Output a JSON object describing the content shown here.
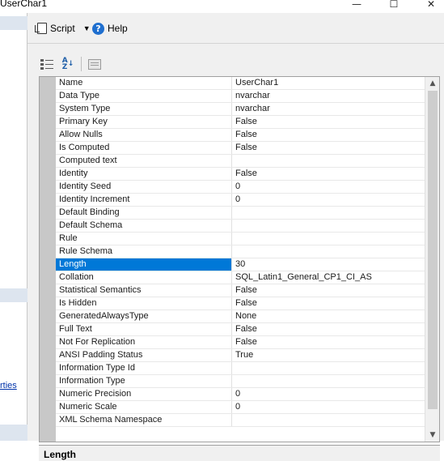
{
  "window": {
    "title": "UserChar1",
    "controls": {
      "minimize": "—",
      "maximize": "☐",
      "close": "✕"
    }
  },
  "left_pane": {
    "link_text": "rties"
  },
  "toolbar": {
    "script_label": "Script",
    "help_label": "Help"
  },
  "property_toolbar": {
    "categorized_icon": "categorized-icon",
    "alphabetical_icon": "sort-az-icon",
    "property_pages_icon": "property-pages-icon"
  },
  "properties": [
    {
      "name": "Name",
      "value": "UserChar1"
    },
    {
      "name": "Data Type",
      "value": "nvarchar"
    },
    {
      "name": "System Type",
      "value": "nvarchar"
    },
    {
      "name": "Primary Key",
      "value": "False"
    },
    {
      "name": "Allow Nulls",
      "value": "False"
    },
    {
      "name": "Is Computed",
      "value": "False"
    },
    {
      "name": "Computed text",
      "value": ""
    },
    {
      "name": "Identity",
      "value": "False"
    },
    {
      "name": "Identity Seed",
      "value": "0"
    },
    {
      "name": "Identity Increment",
      "value": "0"
    },
    {
      "name": "Default Binding",
      "value": ""
    },
    {
      "name": "Default Schema",
      "value": ""
    },
    {
      "name": "Rule",
      "value": ""
    },
    {
      "name": "Rule Schema",
      "value": ""
    },
    {
      "name": "Length",
      "value": "30"
    },
    {
      "name": "Collation",
      "value": "SQL_Latin1_General_CP1_CI_AS"
    },
    {
      "name": "Statistical Semantics",
      "value": "False"
    },
    {
      "name": "Is Hidden",
      "value": "False"
    },
    {
      "name": "GeneratedAlwaysType",
      "value": "None"
    },
    {
      "name": "Full Text",
      "value": "False"
    },
    {
      "name": "Not For Replication",
      "value": "False"
    },
    {
      "name": "ANSI Padding Status",
      "value": "True"
    },
    {
      "name": "Information Type Id",
      "value": ""
    },
    {
      "name": "Information Type",
      "value": ""
    },
    {
      "name": "Numeric Precision",
      "value": "0"
    },
    {
      "name": "Numeric Scale",
      "value": "0"
    },
    {
      "name": "XML Schema Namespace",
      "value": ""
    }
  ],
  "selected_property": "Length",
  "description": {
    "title": "Length"
  },
  "colors": {
    "selection": "#0078d7",
    "gutter": "#c8c8c8",
    "help": "#1f6fcf"
  }
}
